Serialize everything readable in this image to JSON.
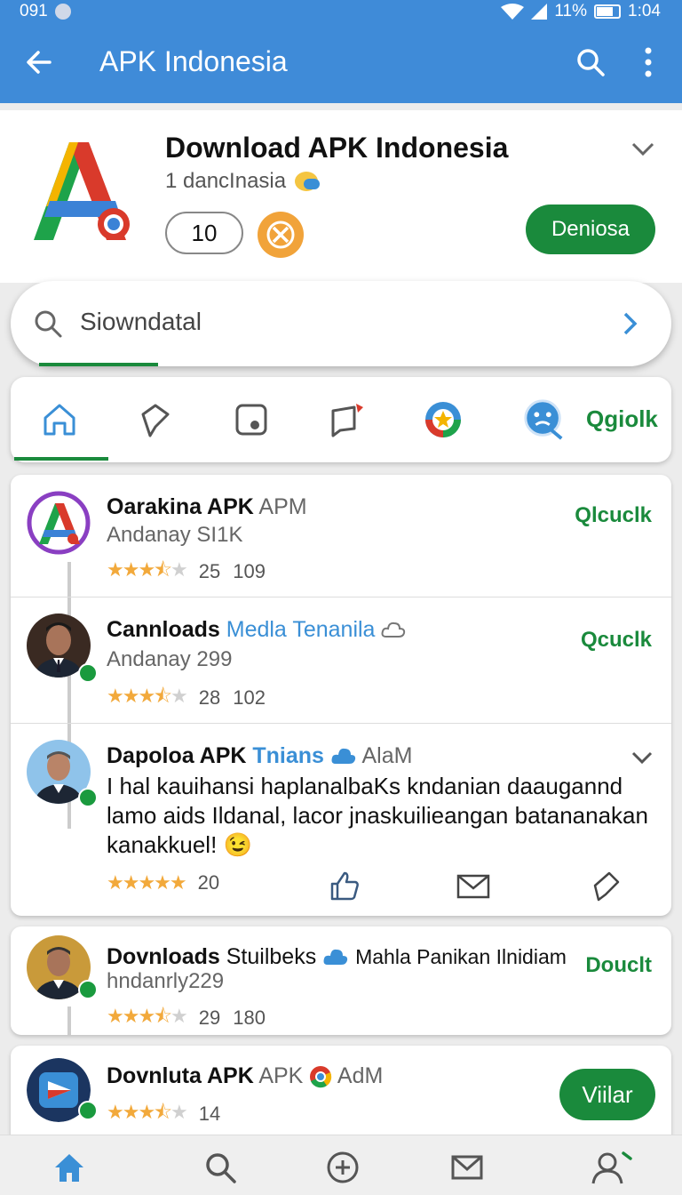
{
  "statusbar": {
    "time_left": "091",
    "battery": "11%",
    "clock": "1:04"
  },
  "appbar": {
    "title": "APK Indonesia"
  },
  "app": {
    "title": "Download APK Indonesia",
    "subtitle": "1  dancInasia",
    "count": "10",
    "download_label": "Deniosa"
  },
  "search": {
    "text": "Siowndatal"
  },
  "tabs": {
    "last_label": "Qgiolk"
  },
  "feed": [
    {
      "title": "Oarakina APK",
      "title_extra": "APM",
      "subtitle": "Andanay SI1K",
      "rating_stars": 3.5,
      "rating_a": "25",
      "rating_b": "109",
      "action": "Qlcuclk"
    },
    {
      "title": "Cannloads",
      "title_extra": "Medla Tenanila",
      "subtitle": "Andanay 299",
      "rating_stars": 3.5,
      "rating_a": "28",
      "rating_b": "102",
      "action": "Qcuclk"
    },
    {
      "title": "Dapoloa APK",
      "title_blue": "Tnians",
      "title_extra": "AlaM",
      "body": "I hal kauihansi haplanalbaKs kndanian daaugannd lamo aids Ildanal, lacor jnaskuilieangan batananakan kanakkuel! 😉",
      "rating_stars": 5,
      "rating_a": "20"
    },
    {
      "title": "Dovnloads",
      "title_extra": "Stuilbeks",
      "title_tail": "Mahla Panikan Ilnidiam",
      "subtitle": "hndanrly229",
      "rating_stars": 3.5,
      "rating_a": "29",
      "rating_b": "180",
      "action": "Douclt"
    },
    {
      "title": "Dovnluta APK",
      "title_extra": "APK",
      "title_tail": "AdM",
      "rating_stars": 3.5,
      "rating_a": "14",
      "action": "Viilar"
    }
  ],
  "colors": {
    "primary": "#3f8bd8",
    "accent_green": "#1a8a3c",
    "star": "#f2a93b"
  }
}
